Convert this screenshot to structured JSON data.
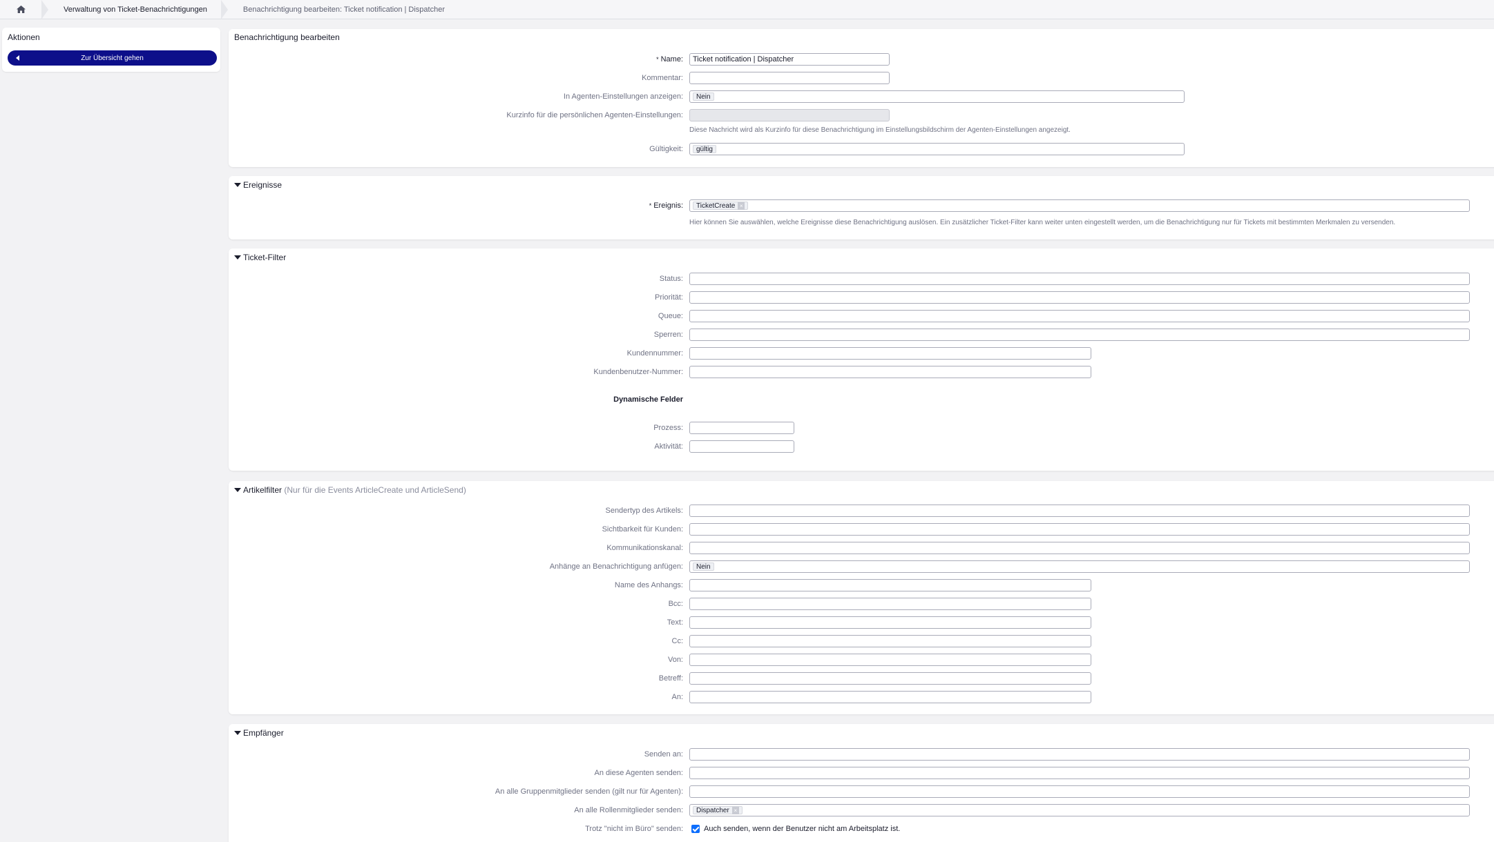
{
  "breadcrumb": {
    "home_icon": "home-icon",
    "items": [
      "Verwaltung von Ticket-Benachrichtigungen",
      "Benachrichtigung bearbeiten: Ticket notification | Dispatcher"
    ]
  },
  "sidebar": {
    "title": "Aktionen",
    "overview_button": "Zur Übersicht gehen"
  },
  "edit": {
    "title": "Benachrichtigung bearbeiten",
    "name_label": "Name:",
    "name_value": "Ticket notification | Dispatcher",
    "comment_label": "Kommentar:",
    "comment_value": "",
    "show_agent_label": "In Agenten-Einstellungen anzeigen:",
    "show_agent_value": "Nein",
    "shortinfo_label": "Kurzinfo für die persönlichen Agenten-Einstellungen:",
    "shortinfo_hint": "Diese Nachricht wird als Kurzinfo für diese Benachrichtigung im Einstellungsbildschirm der Agenten-Einstellungen angezeigt.",
    "validity_label": "Gültigkeit:",
    "validity_value": "gültig"
  },
  "events": {
    "title": "Ereignisse",
    "event_label": "Ereignis:",
    "event_tag": "TicketCreate",
    "hint": "Hier können Sie auswählen, welche Ereignisse diese Benachrichtigung auslösen. Ein zusätzlicher Ticket-Filter kann weiter unten eingestellt werden, um die Benachrichtigung nur für Tickets mit bestimmten Merkmalen zu versenden."
  },
  "ticket_filter": {
    "title": "Ticket-Filter",
    "status": "Status:",
    "priority": "Priorität:",
    "queue": "Queue:",
    "lock": "Sperren:",
    "customer_id": "Kundennummer:",
    "customer_user_id": "Kundenbenutzer-Nummer:",
    "dynamic_fields": "Dynamische Felder",
    "process": "Prozess:",
    "activity": "Aktivität:"
  },
  "article_filter": {
    "title": "Artikelfilter",
    "subtitle": "(Nur für die Events ArticleCreate und ArticleSend)",
    "sender_type": "Sendertyp des Artikels:",
    "visibility": "Sichtbarkeit für Kunden:",
    "channel": "Kommunikationskanal:",
    "attach_label": "Anhänge an Benachrichtigung anfügen:",
    "attach_value": "Nein",
    "attachment_name": "Name des Anhangs:",
    "bcc": "Bcc:",
    "text": "Text:",
    "cc": "Cc:",
    "from": "Von:",
    "subject": "Betreff:",
    "to": "An:"
  },
  "recipients": {
    "title": "Empfänger",
    "send_to": "Senden an:",
    "agents": "An diese Agenten senden:",
    "groups": "An alle Gruppenmitglieder senden (gilt nur für Agenten):",
    "roles_label": "An alle Rollenmitglieder senden:",
    "roles_tag": "Dispatcher",
    "ooo_label": "Trotz \"nicht im Büro\" senden:",
    "ooo_checkbox": "Auch senden, wenn der Benutzer nicht am Arbeitsplatz ist."
  }
}
